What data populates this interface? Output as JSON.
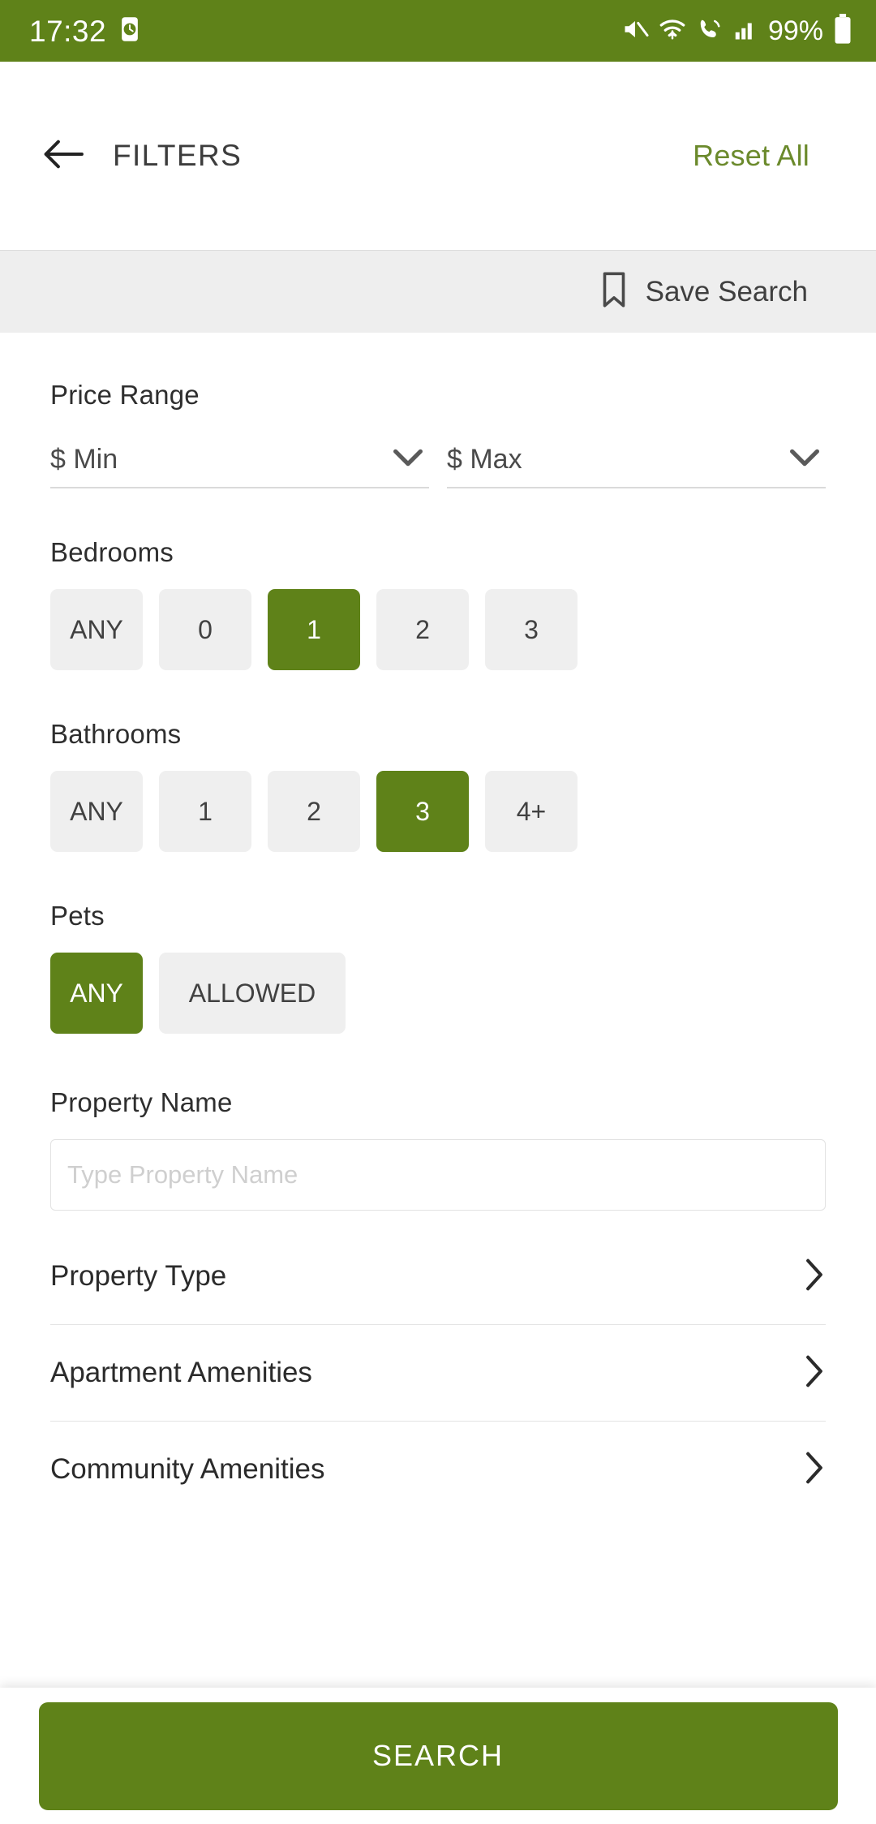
{
  "status_bar": {
    "time": "17:32",
    "battery_percent": "99%",
    "icons": [
      "alarm-clock-icon",
      "mute-icon",
      "wifi-icon",
      "call-icon",
      "signal-icon",
      "battery-icon"
    ],
    "background_color": "#5f8219"
  },
  "header": {
    "back_icon": "back-arrow-icon",
    "title": "FILTERS",
    "reset_label": "Reset All",
    "reset_color": "#6b8a2c"
  },
  "save_bar": {
    "icon": "bookmark-icon",
    "label": "Save Search"
  },
  "price_range": {
    "title": "Price Range",
    "min_value": "$ Min",
    "max_value": "$ Max",
    "chevron_icon": "chevron-down-icon"
  },
  "bedrooms": {
    "title": "Bedrooms",
    "options": [
      {
        "label": "ANY",
        "selected": false
      },
      {
        "label": "0",
        "selected": false
      },
      {
        "label": "1",
        "selected": true
      },
      {
        "label": "2",
        "selected": false
      },
      {
        "label": "3",
        "selected": false
      }
    ]
  },
  "bathrooms": {
    "title": "Bathrooms",
    "options": [
      {
        "label": "ANY",
        "selected": false
      },
      {
        "label": "1",
        "selected": false
      },
      {
        "label": "2",
        "selected": false
      },
      {
        "label": "3",
        "selected": true
      },
      {
        "label": "4+",
        "selected": false
      }
    ]
  },
  "pets": {
    "title": "Pets",
    "options": [
      {
        "label": "ANY",
        "selected": true
      },
      {
        "label": "ALLOWED",
        "selected": false
      }
    ]
  },
  "property_name": {
    "title": "Property Name",
    "placeholder": "Type Property Name",
    "value": ""
  },
  "nav_rows": [
    {
      "label": "Property Type",
      "icon": "chevron-right-icon"
    },
    {
      "label": "Apartment Amenities",
      "icon": "chevron-right-icon"
    },
    {
      "label": "Community Amenities",
      "icon": "chevron-right-icon"
    }
  ],
  "bottom": {
    "search_label": "SEARCH",
    "color": "#5f8219"
  },
  "theme": {
    "accent_green": "#5f8219",
    "chip_gray": "#efefef",
    "savebar_gray": "#eeeeee"
  }
}
